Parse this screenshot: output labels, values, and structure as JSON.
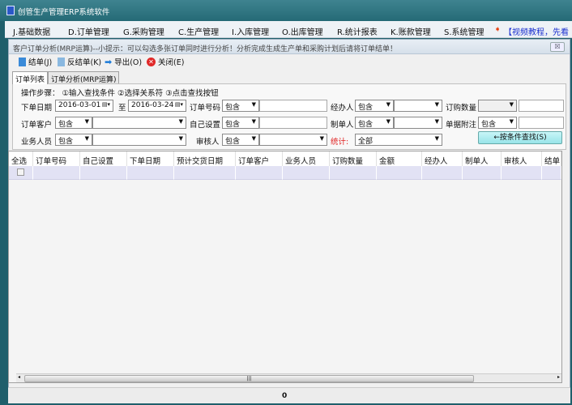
{
  "app": {
    "title": "创管生产管理ERP系统软件"
  },
  "menu": [
    "J.基础数据",
    "D.订单管理",
    "G.采购管理",
    "C.生产管理",
    "I.入库管理",
    "O.出库管理",
    "R.统计报表",
    "K.账款管理",
    "S.系统管理"
  ],
  "menu_promo": "【视频教程，先看",
  "window": {
    "title": "客户订单分析(MRP运算)--小提示：可以勾选多张订单同时进行分析！分析完成生成生产单和采购计划后请将订单结单！",
    "close": "☒"
  },
  "toolbar": {
    "close_order": "结单(J)",
    "reopen_order": "反结单(K)",
    "export": "导出(O)",
    "close": "关闭(E)"
  },
  "tabs": [
    "订单列表",
    "订单分析(MRP运算)"
  ],
  "filters": {
    "steps": "操作步骤：  ①输入查找条件  ②选择关系符  ③点击查找按钮",
    "order_date": "下单日期",
    "date_from": "2016-03-01",
    "to": "至",
    "date_to": "2016-03-24",
    "order_no": "订单号码",
    "handler": "经办人",
    "quantity": "订购数量",
    "customer": "订单客户",
    "custom": "自己设置",
    "creator": "制单人",
    "remark": "单据附注",
    "salesman": "业务人员",
    "reviewer": "审核人",
    "stats": "统计:",
    "stats_value": "全部",
    "contains": "包含",
    "search_button": "←按条件查找(S)"
  },
  "grid": {
    "columns": [
      "全选",
      "订单号码",
      "自己设置",
      "下单日期",
      "预计交货日期",
      "订单客户",
      "业务人员",
      "订购数量",
      "金额",
      "经办人",
      "制单人",
      "审核人",
      "结单"
    ]
  },
  "status": {
    "count": "0"
  },
  "colors": {
    "titlebar": "#2d6f7a",
    "accent_red": "#e02020",
    "search_button": "#a8eef0"
  }
}
